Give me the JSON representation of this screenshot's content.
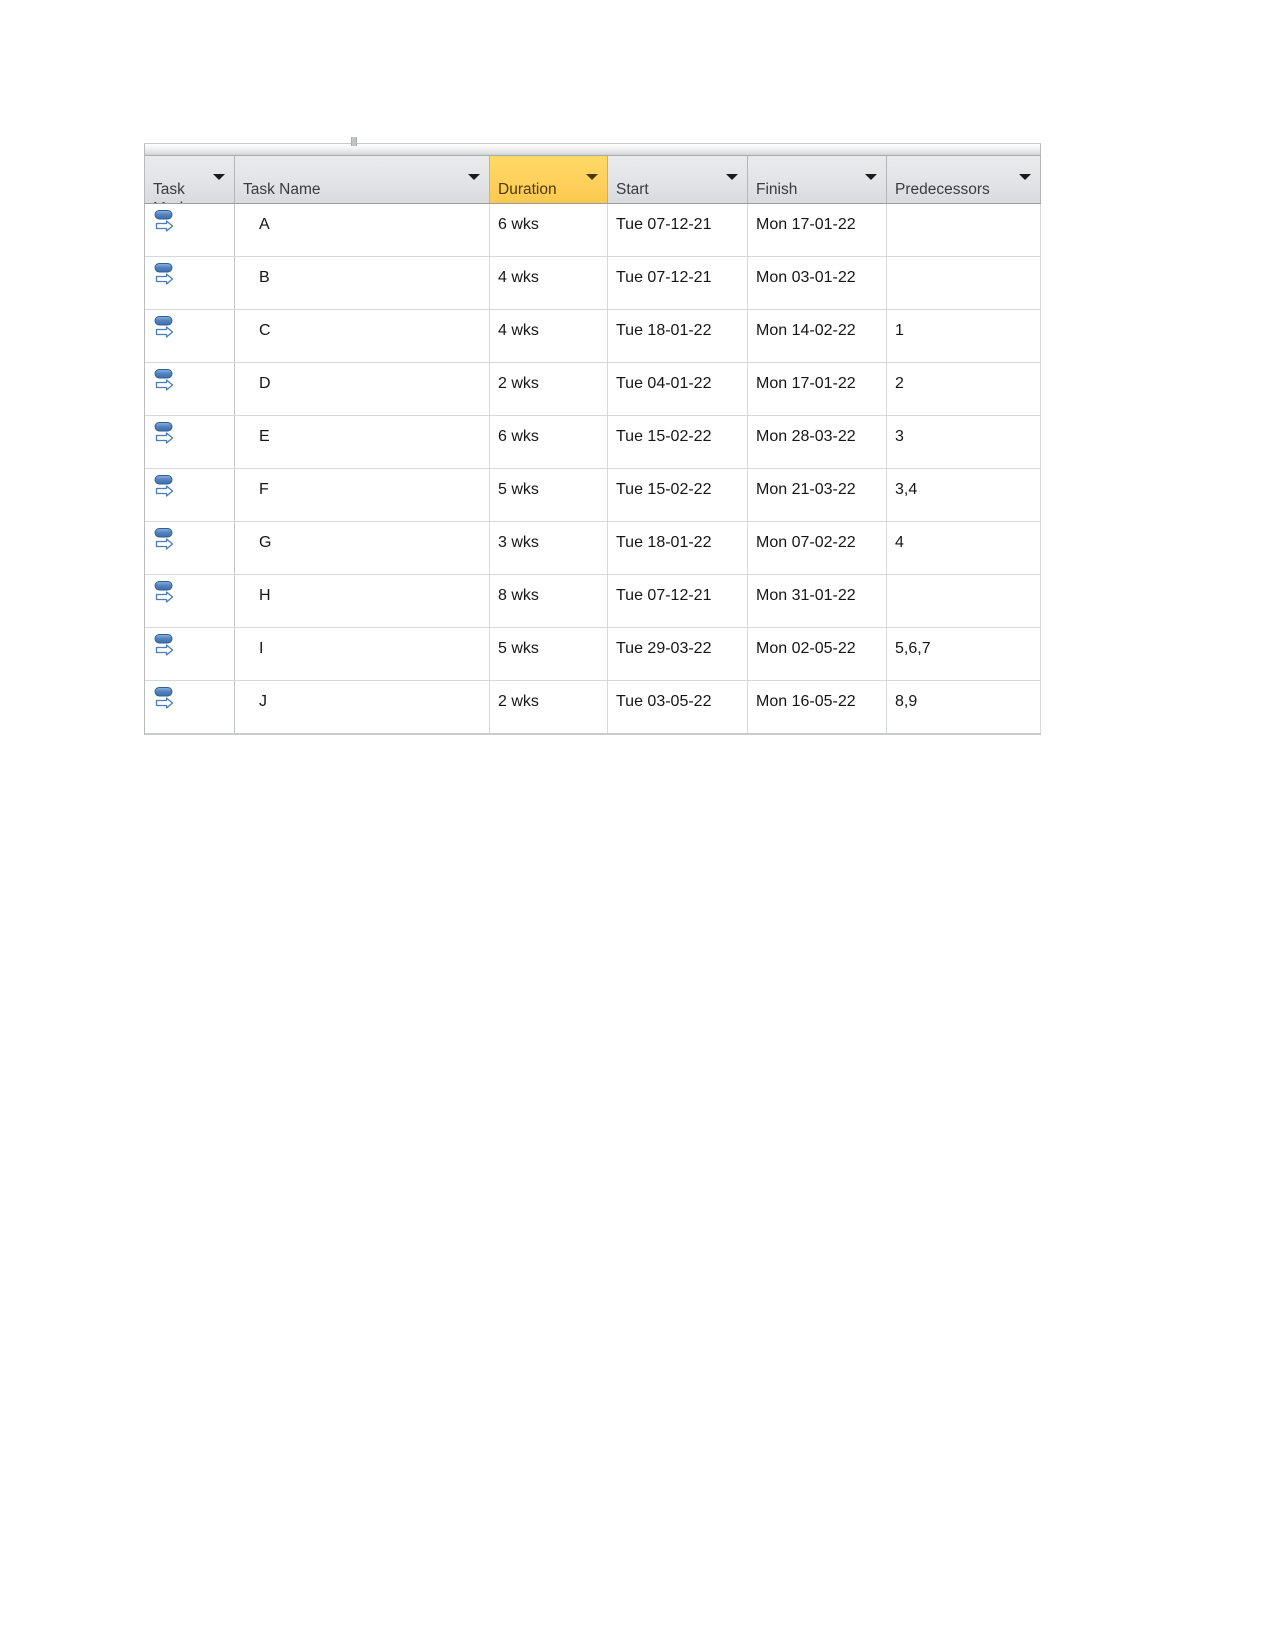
{
  "table": {
    "name": "ms-project-task-entry-table",
    "columns": [
      {
        "key": "task_mode",
        "label": "Task\nMode",
        "highlighted": false
      },
      {
        "key": "task_name",
        "label": "Task Name",
        "highlighted": false
      },
      {
        "key": "duration",
        "label": "Duration",
        "highlighted": true
      },
      {
        "key": "start",
        "label": "Start",
        "highlighted": false
      },
      {
        "key": "finish",
        "label": "Finish",
        "highlighted": false
      },
      {
        "key": "predecessors",
        "label": "Predecessors",
        "highlighted": false
      }
    ],
    "rows": [
      {
        "task_mode_icon": "auto-scheduled-icon",
        "task_name": "A",
        "duration": "6 wks",
        "start": "Tue 07-12-21",
        "finish": "Mon 17-01-22",
        "predecessors": ""
      },
      {
        "task_mode_icon": "auto-scheduled-icon",
        "task_name": "B",
        "duration": "4 wks",
        "start": "Tue 07-12-21",
        "finish": "Mon 03-01-22",
        "predecessors": ""
      },
      {
        "task_mode_icon": "auto-scheduled-icon",
        "task_name": "C",
        "duration": "4 wks",
        "start": "Tue 18-01-22",
        "finish": "Mon 14-02-22",
        "predecessors": "1"
      },
      {
        "task_mode_icon": "auto-scheduled-icon",
        "task_name": "D",
        "duration": "2 wks",
        "start": "Tue 04-01-22",
        "finish": "Mon 17-01-22",
        "predecessors": "2"
      },
      {
        "task_mode_icon": "auto-scheduled-icon",
        "task_name": "E",
        "duration": "6 wks",
        "start": "Tue 15-02-22",
        "finish": "Mon 28-03-22",
        "predecessors": "3"
      },
      {
        "task_mode_icon": "auto-scheduled-icon",
        "task_name": "F",
        "duration": "5 wks",
        "start": "Tue 15-02-22",
        "finish": "Mon 21-03-22",
        "predecessors": "3,4"
      },
      {
        "task_mode_icon": "auto-scheduled-icon",
        "task_name": "G",
        "duration": "3 wks",
        "start": "Tue 18-01-22",
        "finish": "Mon 07-02-22",
        "predecessors": "4"
      },
      {
        "task_mode_icon": "auto-scheduled-icon",
        "task_name": "H",
        "duration": "8 wks",
        "start": "Tue 07-12-21",
        "finish": "Mon 31-01-22",
        "predecessors": ""
      },
      {
        "task_mode_icon": "auto-scheduled-icon",
        "task_name": "I",
        "duration": "5 wks",
        "start": "Tue 29-03-22",
        "finish": "Mon 02-05-22",
        "predecessors": "5,6,7"
      },
      {
        "task_mode_icon": "auto-scheduled-icon",
        "task_name": "J",
        "duration": "2 wks",
        "start": "Tue 03-05-22",
        "finish": "Mon 16-05-22",
        "predecessors": "8,9"
      }
    ]
  },
  "colors": {
    "header_background": "#dfe1e4",
    "header_highlight": "#ffd15e",
    "grid_line": "#d6d8db",
    "icon_blue": "#4a7ebb",
    "text": "#161616"
  }
}
